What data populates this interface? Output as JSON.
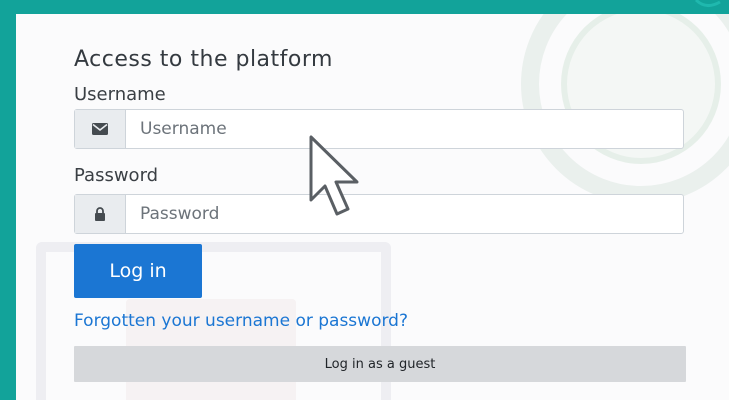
{
  "login": {
    "title": "Access to the platform",
    "username_label": "Username",
    "username_placeholder": "Username",
    "username_icon": "envelope-icon",
    "password_label": "Password",
    "password_placeholder": "Password",
    "password_icon": "lock-icon",
    "login_button": "Log in",
    "forgot_link": "Forgotten your username or password?",
    "guest_button": "Log in as a guest"
  },
  "colors": {
    "frame": "#12a39a",
    "primary": "#1b76d3",
    "guest_button_bg": "#d6d8db",
    "addon_bg": "#e9ecef"
  }
}
